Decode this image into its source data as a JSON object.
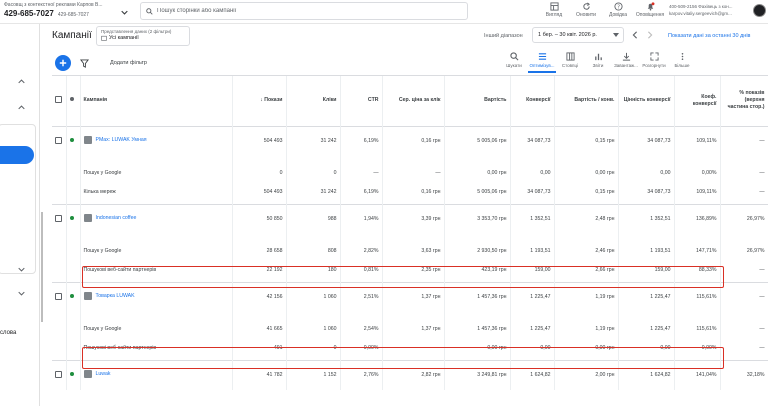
{
  "header": {
    "account_name": "Фасовщ з контекстної реклами Карпов В...",
    "account_id": "429-685-7027",
    "account_sub_id": "429-685-7027",
    "search_placeholder": "Пошук сторінки або кампанії",
    "tools": [
      {
        "label": "Вигляд",
        "icon": "view-icon"
      },
      {
        "label": "Оновити",
        "icon": "refresh-icon"
      },
      {
        "label": "Довідка",
        "icon": "help-icon"
      },
      {
        "label": "Оповіщення",
        "icon": "bell-icon"
      }
    ],
    "user_line1": "400-509-2156 Фахівець з кон...",
    "user_line2": "karpov.vitaliy.sergeevich@gm..."
  },
  "sidebar": {
    "partial_label": "слова"
  },
  "page": {
    "title": "Кампанії",
    "preset_label": "Представлення даних (2 фільтри)",
    "preset_value": "Усі кампанії",
    "range_label": "Інший діапазон",
    "range_value": "1 бер. – 30 квіт. 2026 р.",
    "last30_link": "Показати дані за останні 30 днів",
    "add_filter": "Додати фільтр"
  },
  "toolbar": [
    {
      "label": "Шукати",
      "icon": "search-icon"
    },
    {
      "label": "Оптимізув...",
      "icon": "segment-icon",
      "active": true
    },
    {
      "label": "Стовпці",
      "icon": "columns-icon"
    },
    {
      "label": "Звіти",
      "icon": "reports-icon"
    },
    {
      "label": "Завантаж...",
      "icon": "download-icon"
    },
    {
      "label": "Розгорнути",
      "icon": "expand-icon"
    },
    {
      "label": "Більше",
      "icon": "more-icon"
    }
  ],
  "columns": [
    "Кампанія",
    "Покази",
    "Кліки",
    "CTR",
    "Сер. ціна за клік",
    "Вартість",
    "Конверсії",
    "Вартість / конв.",
    "Цінність конверсії",
    "Коеф. конверсії",
    "% показів (верхня частина стор.)"
  ],
  "rows": [
    {
      "type": "camp",
      "name": "PMax: LUWAK Умная",
      "cells": [
        "504 493",
        "31 242",
        "6,19%",
        "0,16 грн",
        "5 005,06 грн",
        "34 087,73",
        "0,15 грн",
        "34 087,73",
        "109,11%",
        "—"
      ]
    },
    {
      "type": "sub",
      "name": "Пошук у Google",
      "cells": [
        "0",
        "0",
        "—",
        "—",
        "0,00 грн",
        "0,00",
        "0,00 грн",
        "0,00",
        "0,00%",
        "—"
      ]
    },
    {
      "type": "sub",
      "name": "Кілька мереж",
      "cells": [
        "504 493",
        "31 242",
        "6,19%",
        "0,16 грн",
        "5 005,06 грн",
        "34 087,73",
        "0,15 грн",
        "34 087,73",
        "109,11%",
        "—"
      ]
    },
    {
      "type": "camp",
      "name": "Indonesian coffee",
      "cells": [
        "50 850",
        "988",
        "1,94%",
        "3,39 грн",
        "3 353,70 грн",
        "1 352,51",
        "2,48 грн",
        "1 352,51",
        "136,89%",
        "26,97%"
      ]
    },
    {
      "type": "sub",
      "name": "Пошук у Google",
      "cells": [
        "28 658",
        "808",
        "2,82%",
        "3,63 грн",
        "2 930,50 грн",
        "1 193,51",
        "2,46 грн",
        "1 193,51",
        "147,71%",
        "26,97%"
      ]
    },
    {
      "type": "sub",
      "name": "Пошукові веб-сайти партнерів",
      "cells": [
        "22 192",
        "180",
        "0,81%",
        "2,35 грн",
        "423,19 грн",
        "159,00",
        "2,66 грн",
        "159,00",
        "88,33%",
        "—"
      ]
    },
    {
      "type": "camp",
      "name": "Товарка LUWAK",
      "cells": [
        "42 156",
        "1 060",
        "2,51%",
        "1,37 грн",
        "1 457,36 грн",
        "1 225,47",
        "1,19 грн",
        "1 225,47",
        "115,61%",
        "—"
      ]
    },
    {
      "type": "sub",
      "name": "Пошук у Google",
      "cells": [
        "41 665",
        "1 060",
        "2,54%",
        "1,37 грн",
        "1 457,36 грн",
        "1 225,47",
        "1,19 грн",
        "1 225,47",
        "115,61%",
        "—"
      ]
    },
    {
      "type": "sub",
      "name": "Пошукові веб-сайти партнерів",
      "cells": [
        "491",
        "0",
        "0,00%",
        "—",
        "0,00 грн",
        "0,00",
        "0,00 грн",
        "0,00",
        "0,00%",
        "—"
      ]
    },
    {
      "type": "camp",
      "name": "Luwak",
      "cells": [
        "41 782",
        "1 152",
        "2,76%",
        "2,82 грн",
        "3 249,81 грн",
        "1 624,82",
        "2,00 грн",
        "1 624,82",
        "141,04%",
        "32,18%"
      ]
    }
  ],
  "colors": {
    "accent": "#1a73e8",
    "highlight": "#d93025",
    "status": "#1e8e3e"
  }
}
